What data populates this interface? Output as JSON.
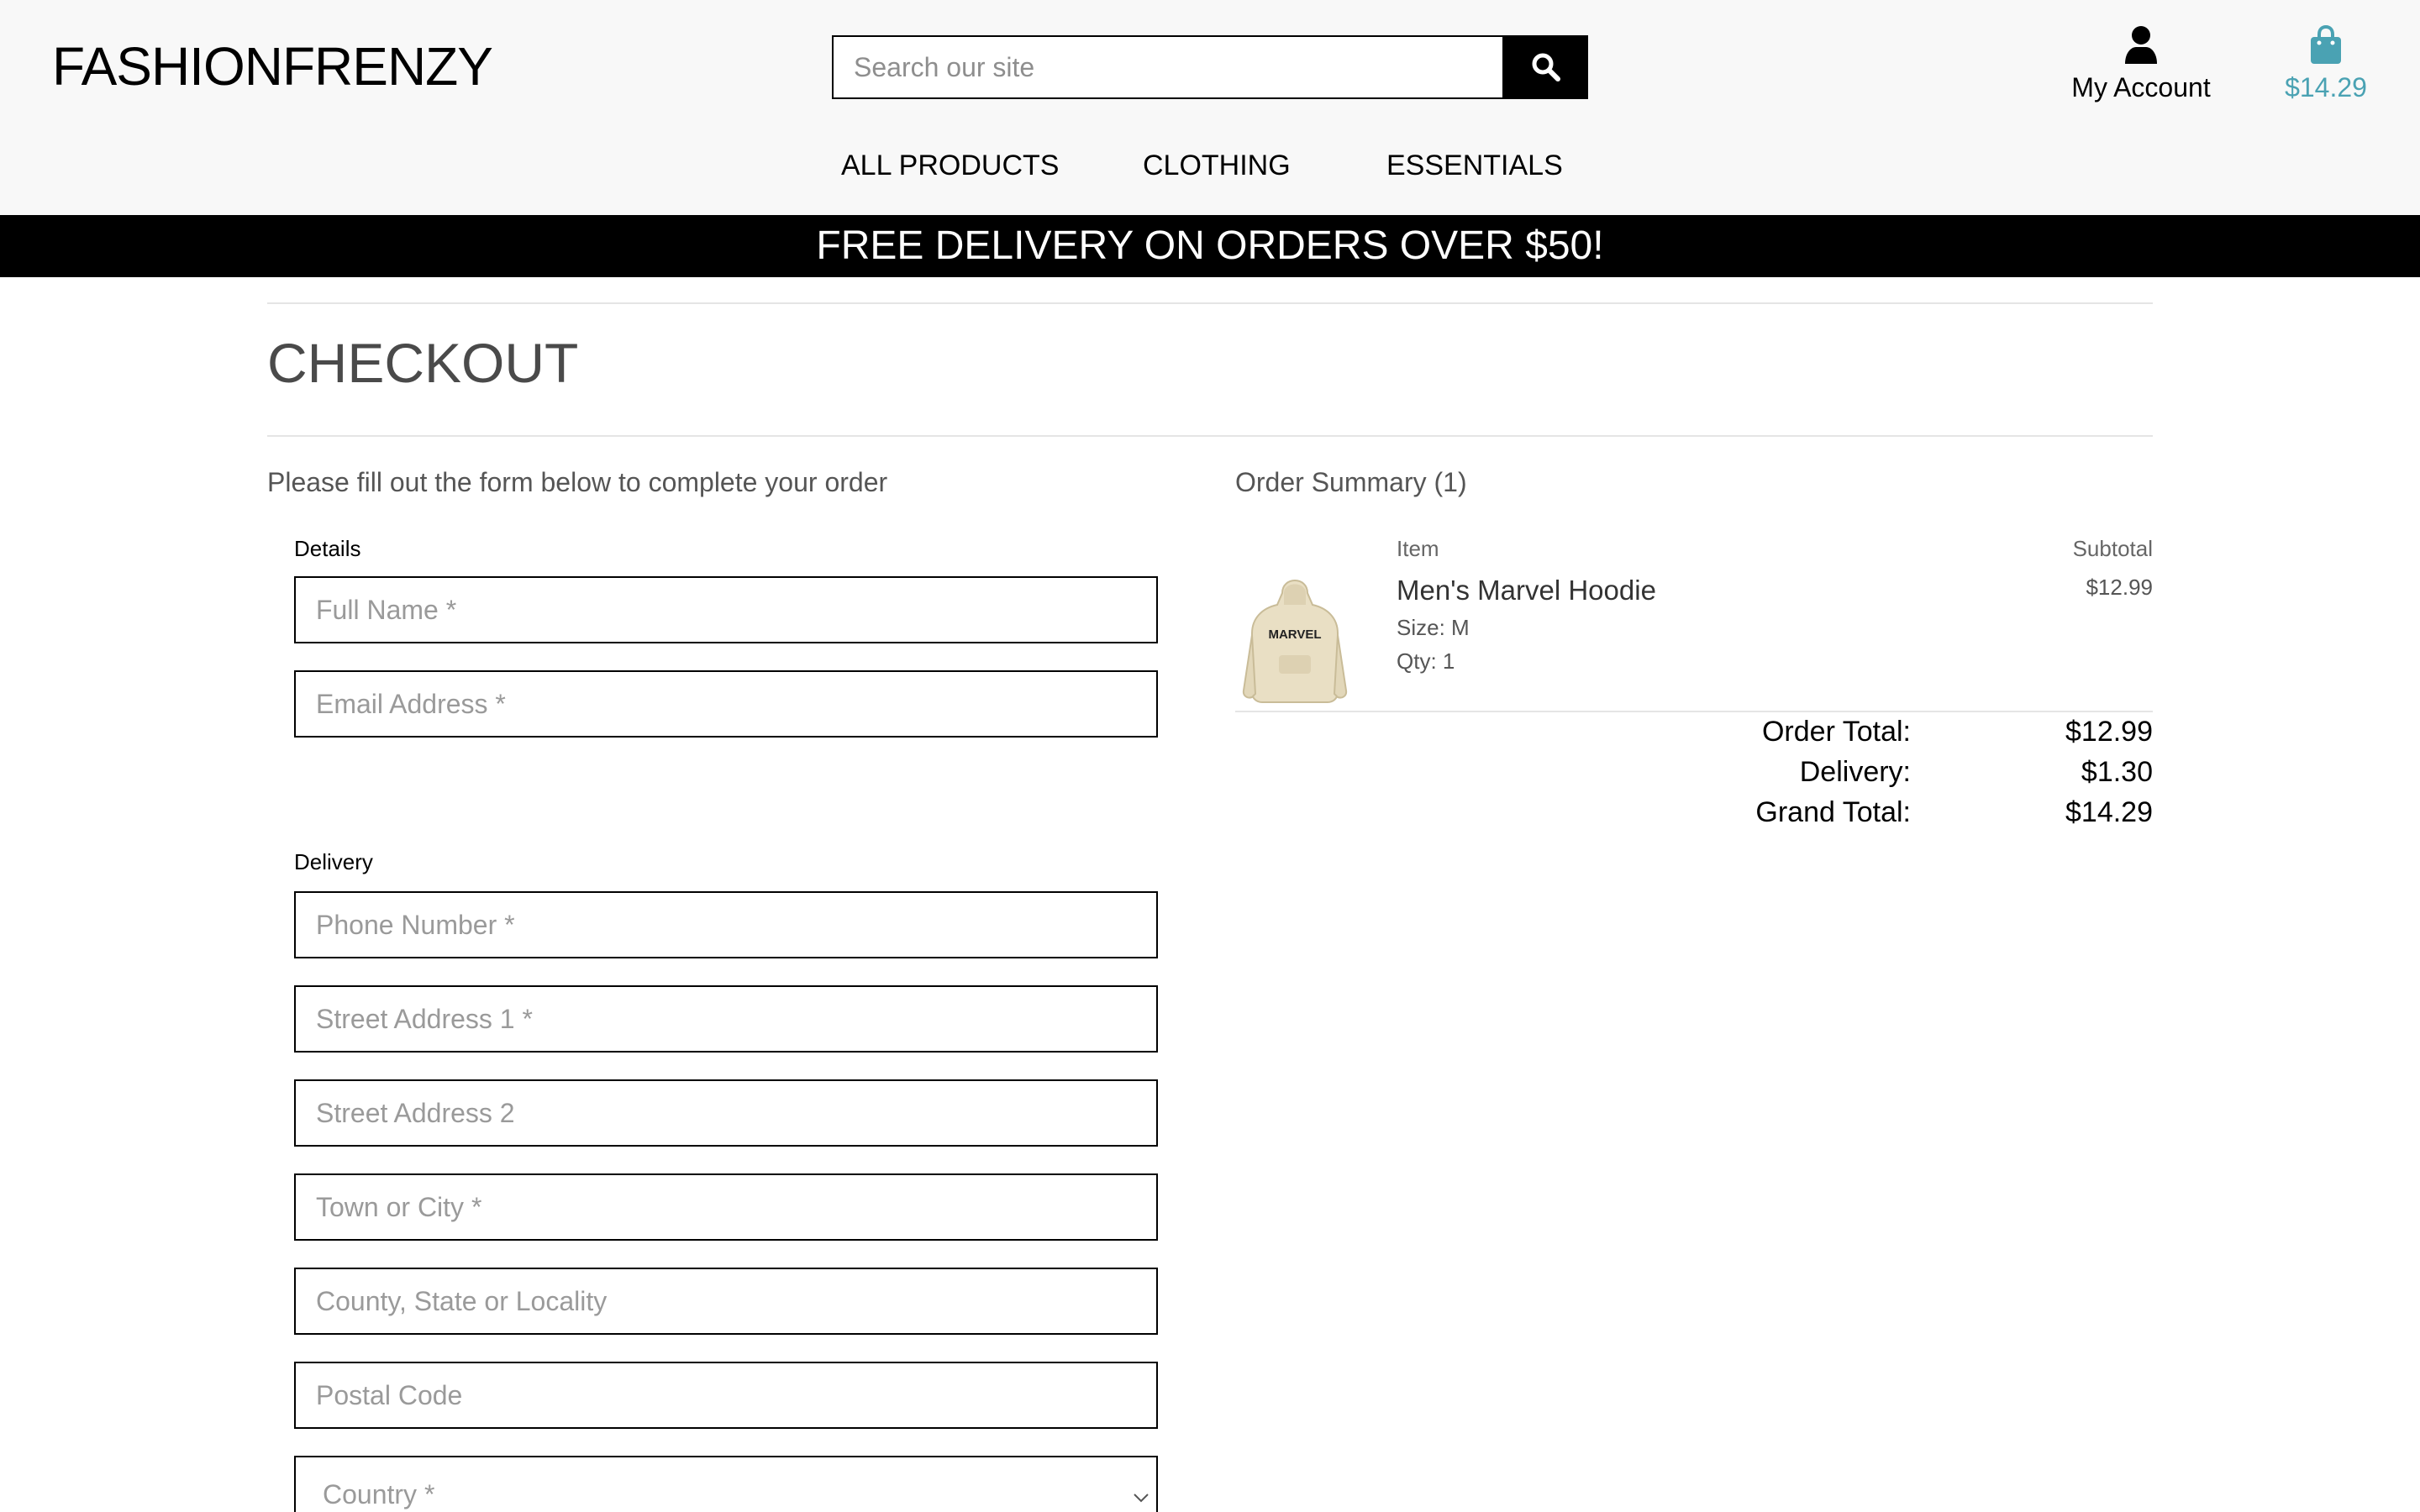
{
  "header": {
    "logo": "FASHIONFRENZY",
    "search": {
      "placeholder": "Search our site"
    },
    "account_label": "My Account",
    "bag_total": "$14.29"
  },
  "nav": {
    "items": [
      {
        "label": "ALL PRODUCTS"
      },
      {
        "label": "CLOTHING"
      },
      {
        "label": "ESSENTIALS"
      }
    ]
  },
  "banner": {
    "text": "FREE DELIVERY ON ORDERS OVER $50!"
  },
  "checkout": {
    "title": "CHECKOUT",
    "intro": "Please fill out the form below to complete your order",
    "details_label": "Details",
    "details_fields": [
      {
        "placeholder": "Full Name *",
        "value": ""
      },
      {
        "placeholder": "Email Address *",
        "value": ""
      }
    ],
    "delivery_label": "Delivery",
    "delivery_fields": [
      {
        "placeholder": "Phone Number *",
        "value": ""
      },
      {
        "placeholder": "Street Address 1 *",
        "value": ""
      },
      {
        "placeholder": "Street Address 2",
        "value": ""
      },
      {
        "placeholder": "Town or City *",
        "value": ""
      },
      {
        "placeholder": "County, State or Locality",
        "value": ""
      },
      {
        "placeholder": "Postal Code",
        "value": ""
      }
    ],
    "country_select": {
      "selected": "Country *"
    }
  },
  "summary": {
    "title": "Order Summary (1)",
    "col_item": "Item",
    "col_subtotal": "Subtotal",
    "product": {
      "name": "Men's Marvel Hoodie",
      "size": "Size: M",
      "qty": "Qty: 1",
      "subtotal": "$12.99",
      "thumb_text": "MARVEL"
    },
    "totals": {
      "order_total_label": "Order Total:",
      "order_total": "$12.99",
      "delivery_label": "Delivery:",
      "delivery": "$1.30",
      "grand_total_label": "Grand Total:",
      "grand_total": "$14.29"
    }
  },
  "colors": {
    "accent": "#4aa2b3",
    "banner_bg": "#000000",
    "header_bg": "#f8f8f8"
  }
}
